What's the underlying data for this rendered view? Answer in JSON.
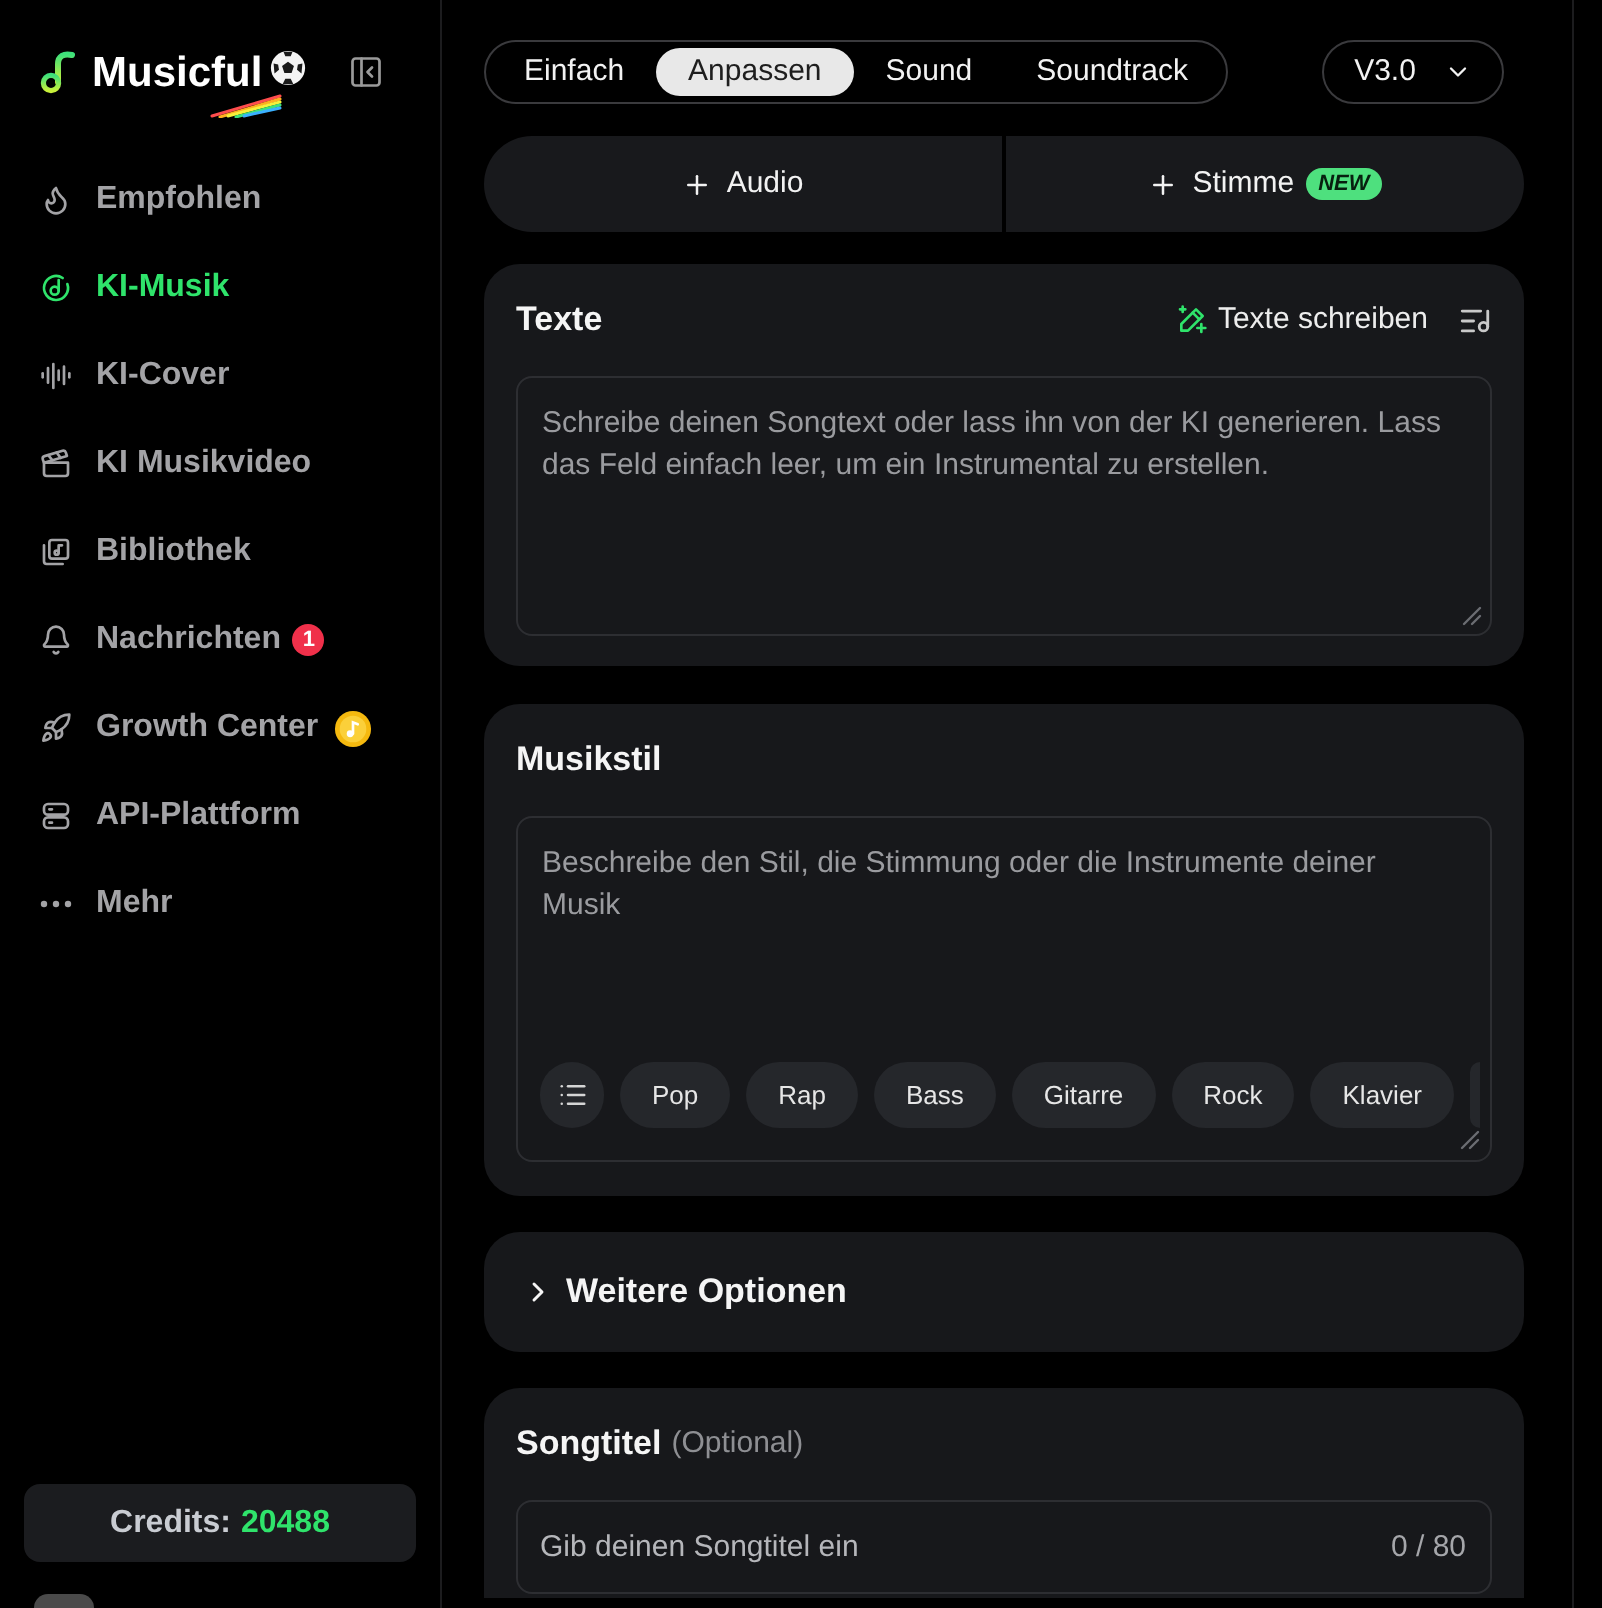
{
  "sidebar": {
    "logo": {
      "text": "Musicful"
    },
    "nav_items": [
      {
        "label": "Empfohlen",
        "selected": false
      },
      {
        "label": "KI-Musik",
        "selected": true
      },
      {
        "label": "KI-Cover",
        "selected": false
      },
      {
        "label": "KI Musikvideo",
        "selected": false
      },
      {
        "label": "Bibliothek",
        "selected": false
      },
      {
        "label": "Nachrichten",
        "selected": false,
        "badge": {
          "kind": "count",
          "text": "1"
        }
      },
      {
        "label": "Growth Center",
        "selected": false,
        "badge": {
          "kind": "coin"
        }
      },
      {
        "label": "API-Plattform",
        "selected": false
      },
      {
        "label": "Mehr",
        "selected": false
      }
    ],
    "credits": {
      "label": "Credits:",
      "value": "20488"
    }
  },
  "mode_tabs": [
    {
      "label": "Einfach",
      "selected": false
    },
    {
      "label": "Anpassen",
      "selected": true
    },
    {
      "label": "Sound",
      "selected": false
    },
    {
      "label": "Soundtrack",
      "selected": false
    }
  ],
  "version_select": {
    "value": "V3.0"
  },
  "add_buttons": [
    {
      "label": "Audio"
    },
    {
      "label": "Stimme",
      "badge": "NEW"
    }
  ],
  "lyrics_card": {
    "title": "Texte",
    "action": "Texte schreiben",
    "placeholder": "Schreibe deinen Songtext oder lass ihn von der KI generieren. Lass das Feld einfach leer, um ein Instrumental zu erstellen."
  },
  "style_card": {
    "title": "Musikstil",
    "placeholder": "Beschreibe den Stil, die Stimmung oder die Instrumente deiner Musik",
    "tags": [
      "Pop",
      "Rap",
      "Bass",
      "Gitarre",
      "Rock",
      "Klavier"
    ]
  },
  "more_options": {
    "label": "Weitere Optionen",
    "expanded": false
  },
  "title_card": {
    "title": "Songtitel",
    "note": "(Optional)",
    "placeholder": "Gib deinen Songtitel ein",
    "counter": "0 / 80"
  }
}
